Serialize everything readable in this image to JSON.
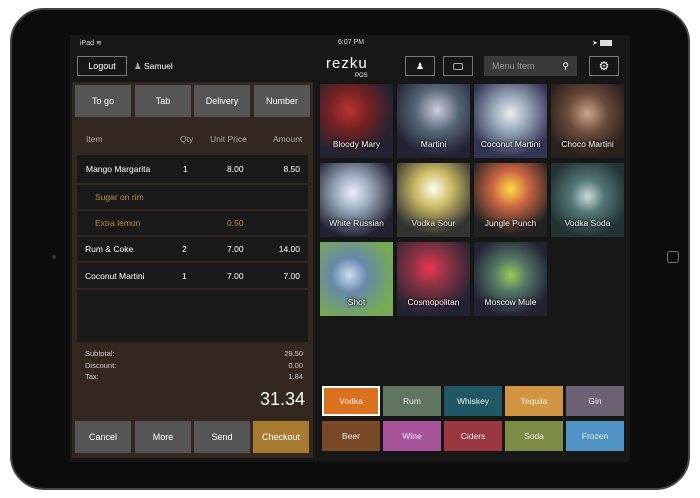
{
  "status": {
    "device": "iPad",
    "time": "6:07 PM"
  },
  "header": {
    "logout": "Logout",
    "user": "Samuel",
    "logo": "rezku",
    "logo_sub": "POS",
    "search_placeholder": "Menu Item"
  },
  "order_types": [
    "To go",
    "Tab",
    "Delivery",
    "Number"
  ],
  "columns": [
    "Item",
    "Qty",
    "Unit Price",
    "Amount"
  ],
  "items": [
    {
      "name": "Mango Margarita",
      "qty": "1",
      "price": "8.00",
      "amount": "8.50"
    },
    {
      "name": "Sugar on rim",
      "qty": "",
      "price": "",
      "amount": ""
    },
    {
      "name": "Extra lemon",
      "qty": "",
      "price": "0.50",
      "amount": ""
    },
    {
      "name": "Rum & Coke",
      "qty": "2",
      "price": "7.00",
      "amount": "14.00"
    },
    {
      "name": "Coconut Martini",
      "qty": "1",
      "price": "7.00",
      "amount": "7.00"
    }
  ],
  "summary": {
    "subtotal_label": "Subtotal:",
    "subtotal": "29.50",
    "discount_label": "Discount:",
    "discount": "0.00",
    "tax_label": "Tax:",
    "tax": "1.84",
    "total": "31.34"
  },
  "actions": [
    "Cancel",
    "More",
    "Send",
    "Checkout"
  ],
  "drinks": [
    "Bloody Mary",
    "Martini",
    "Coconut Martini",
    "Choco Martini",
    "White Russian",
    "Vodka Sour",
    "Jungle Punch",
    "Vodka Soda",
    "Shot",
    "Cosmopolitan",
    "Moscow Mule"
  ],
  "categories": [
    {
      "label": "Vodka",
      "color": "#d9711f"
    },
    {
      "label": "Rum",
      "color": "#5f7560"
    },
    {
      "label": "Whiskey",
      "color": "#1f5766"
    },
    {
      "label": "Tequila",
      "color": "#d39441"
    },
    {
      "label": "Gin",
      "color": "#6b6373"
    },
    {
      "label": "Beer",
      "color": "#7a4a26"
    },
    {
      "label": "Wine",
      "color": "#a8549a"
    },
    {
      "label": "Ciders",
      "color": "#9a3740"
    },
    {
      "label": "Soda",
      "color": "#7b8c45"
    },
    {
      "label": "Frozen",
      "color": "#4f92c4"
    }
  ]
}
